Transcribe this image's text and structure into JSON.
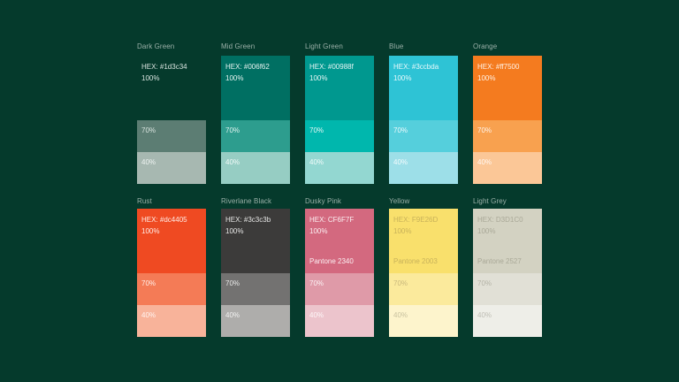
{
  "swatches": [
    {
      "name": "Dark Green",
      "hex": "HEX: #1d3c34",
      "full": "100%",
      "p70": "70%",
      "p40": "40%",
      "colors": {
        "c100": "#053a2c",
        "c70": "#5c7d73",
        "c40": "#a7b8b1"
      },
      "text": {
        "c100": "#d8e3de",
        "c70": "#d8e3de",
        "c40": "#eef3f1"
      }
    },
    {
      "name": "Mid Green",
      "hex": "HEX: #006f62",
      "full": "100%",
      "p70": "70%",
      "p40": "40%",
      "colors": {
        "c100": "#006f62",
        "c70": "#2d9d8e",
        "c40": "#96cdc3"
      },
      "text": {
        "c100": "#e6f3f0",
        "c70": "#dff2ee",
        "c40": "#f1faf8"
      }
    },
    {
      "name": "Light Green",
      "hex": "HEX: #00988f",
      "full": "100%",
      "p70": "70%",
      "p40": "40%",
      "colors": {
        "c100": "#00988f",
        "c70": "#00b7ad",
        "c40": "#93d7d1"
      },
      "text": {
        "c100": "#e6f6f5",
        "c70": "#e3f7f5",
        "c40": "#f1fbfa"
      }
    },
    {
      "name": "Blue",
      "hex": "HEX: #3ccbda",
      "full": "100%",
      "p70": "70%",
      "p40": "40%",
      "colors": {
        "c100": "#2ec3d5",
        "c70": "#55cfdc",
        "c40": "#9ddfe8"
      },
      "text": {
        "c100": "#e8f9fb",
        "c70": "#edfafc",
        "c40": "#f4fcfd"
      }
    },
    {
      "name": "Orange",
      "hex": "HEX: #ff7500",
      "full": "100%",
      "p70": "70%",
      "p40": "40%",
      "colors": {
        "c100": "#f47b1f",
        "c70": "#f8a14f",
        "c40": "#fbc797"
      },
      "text": {
        "c100": "#fff2e6",
        "c70": "#fff4ea",
        "c40": "#fff8f2"
      }
    },
    {
      "name": "Rust",
      "hex": "HEX: #dc4405",
      "full": "100%",
      "p70": "70%",
      "p40": "40%",
      "colors": {
        "c100": "#ef4a22",
        "c70": "#f47b56",
        "c40": "#f8b39a"
      },
      "text": {
        "c100": "#ffece6",
        "c70": "#ffefe9",
        "c40": "#fff5f1"
      }
    },
    {
      "name": "Riverlane Black",
      "hex": "HEX: #3c3c3b",
      "full": "100%",
      "p70": "70%",
      "p40": "40%",
      "colors": {
        "c100": "#3c3b3a",
        "c70": "#737271",
        "c40": "#aeadab"
      },
      "text": {
        "c100": "#e6e6e5",
        "c70": "#e8e8e7",
        "c40": "#f2f2f1"
      }
    },
    {
      "name": "Dusky Pink",
      "hex": "HEX: CF6F7F",
      "full": "100%",
      "pantone": "Pantone 2340",
      "p70": "70%",
      "p40": "40%",
      "colors": {
        "c100": "#d3697f",
        "c70": "#df9aa8",
        "c40": "#ecc4cc"
      },
      "text": {
        "c100": "#fbeef1",
        "c70": "#fcf2f4",
        "c40": "#fdf7f8"
      }
    },
    {
      "name": "Yellow",
      "hex": "HEX: F9E26D",
      "full": "100%",
      "pantone": "Pantone 2003",
      "p70": "70%",
      "p40": "40%",
      "colors": {
        "c100": "#f9e06c",
        "c70": "#fbea9c",
        "c40": "#fdf4cc"
      },
      "text": {
        "c100": "#c8b25a",
        "c70": "#c9b87c",
        "c40": "#c9c2a0"
      }
    },
    {
      "name": "Light Grey",
      "hex": "HEX: D3D1C0",
      "full": "100%",
      "pantone": "Pantone 2527",
      "p70": "70%",
      "p40": "40%",
      "colors": {
        "c100": "#d3d2c2",
        "c70": "#e1e0d6",
        "c40": "#eeeee8"
      },
      "text": {
        "c100": "#aaa998",
        "c70": "#b3b2a6",
        "c40": "#bebdb4"
      }
    }
  ]
}
